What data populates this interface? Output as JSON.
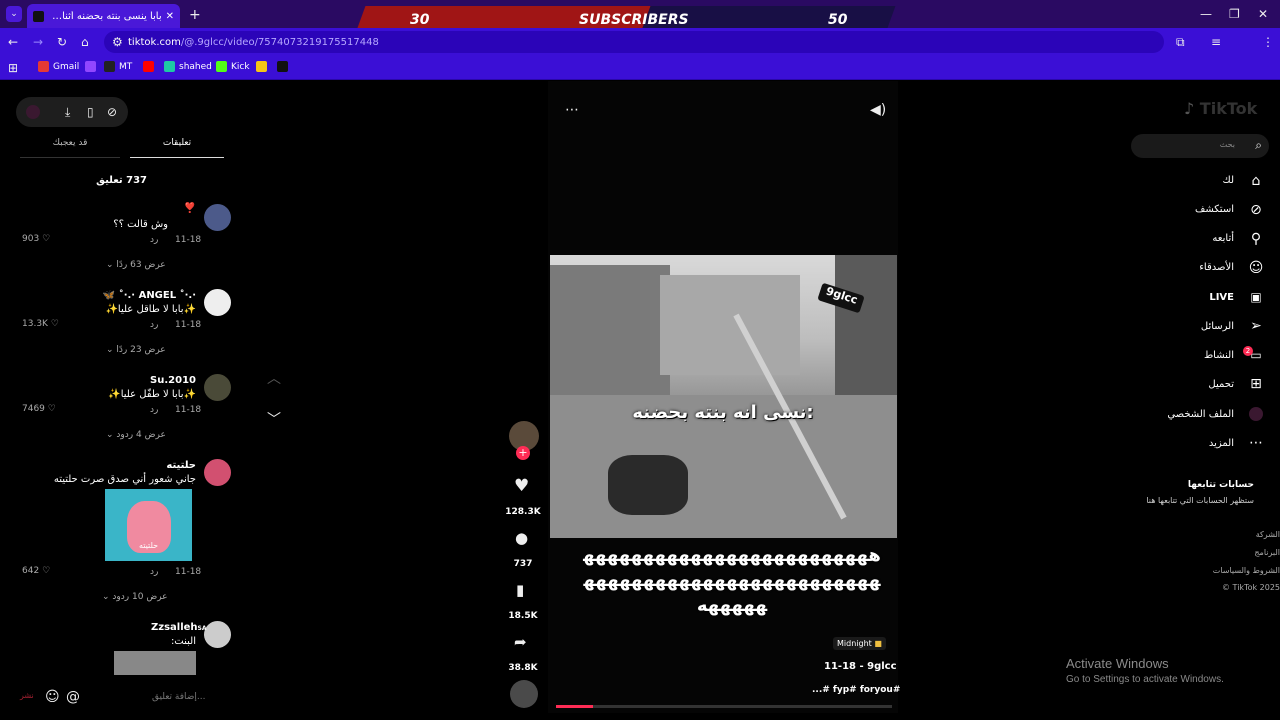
{
  "browser": {
    "tab_title": "بابا ينسى بنته بحضنه أثناء اللعب |",
    "url_host": "tiktok.com",
    "url_path": "/@.9glcc/video/7574073219175517448",
    "bookmarks": [
      "Gmail",
      "MT",
      "shahed",
      "Kick"
    ],
    "window_controls": [
      "minimize-icon",
      "restore-icon",
      "close-icon"
    ]
  },
  "overlay": {
    "left": "30",
    "center": "SUBSCRIBERS",
    "right": "50",
    "colors": {
      "left": "#a01515",
      "right": "#180f45"
    }
  },
  "comments_panel": {
    "tabs": {
      "comments": "تعليقات",
      "you_may_like": "قد يعجبك"
    },
    "count_label": "737 تعليق",
    "reply_label": "رد",
    "items": [
      {
        "user": "❣️",
        "text": "وش قالت ؟؟",
        "date": "11-18",
        "likes": "903",
        "replies": "عرض 63 ردًا"
      },
      {
        "user": "·.·˚ ANGEL ·.·˚ 🦋",
        "text": "✨بابا لا طاقل عليا✨",
        "date": "11-18",
        "likes": "13.3K",
        "replies": "عرض 23 ردًا"
      },
      {
        "user": "Su.2010",
        "text": "✨بابا لا طفّل عليا✨",
        "date": "11-18",
        "likes": "7469",
        "replies": "عرض 4 ردود"
      },
      {
        "user": "حلتيته",
        "text": "جاني شعور أني صدق صرت حلتيته",
        "date": "11-18",
        "likes": "642",
        "replies": "عرض 10 ردود",
        "sticker_caption": "حلتيته"
      },
      {
        "user": "Zzsalleh",
        "user_suffix": "SA",
        "text": "البنت:"
      }
    ],
    "input_placeholder": "إضافة تعليق...",
    "input_left": "نشر"
  },
  "video": {
    "watermark": "9glcc",
    "caption_top": "نسى انه بنته  بحضنه:",
    "caption_bottom": "هههههههههههههههههههههههههههههههههههههههههههههههههههههههه",
    "music_tag": "Midnight",
    "author": "9glcc",
    "date": "11-18",
    "hashtags": "...# fyp# foryou#",
    "progress": 0.11
  },
  "actions": {
    "likes": "128.3K",
    "comments": "737",
    "saves": "18.5K",
    "shares": "38.8K"
  },
  "tiktok_nav": {
    "logo": "TikTok",
    "search_placeholder": "بحث",
    "items": [
      {
        "label": "لك",
        "icon": "home-icon"
      },
      {
        "label": "استكشف",
        "icon": "compass-icon"
      },
      {
        "label": "أتابعه",
        "icon": "user-follow-icon"
      },
      {
        "label": "الأصدقاء",
        "icon": "friends-icon"
      },
      {
        "label": "LIVE",
        "icon": "live-icon"
      },
      {
        "label": "الرسائل",
        "icon": "send-icon"
      },
      {
        "label": "النشاط",
        "icon": "inbox-icon",
        "badge": "2"
      },
      {
        "label": "تحميل",
        "icon": "upload-icon"
      },
      {
        "label": "الملف الشخصي",
        "icon": "profile-icon"
      },
      {
        "label": "المزيد",
        "icon": "more-icon"
      }
    ],
    "following_title": "حسابات تتابعها",
    "following_sub": "ستظهر الحسابات التي تتابعها هنا",
    "footer": [
      "الشركة",
      "البرنامج",
      "الشروط والسياسات",
      "TikTok 2025 ©"
    ]
  },
  "windows_notice": {
    "title": "Activate Windows",
    "sub": "Go to Settings to activate Windows."
  }
}
